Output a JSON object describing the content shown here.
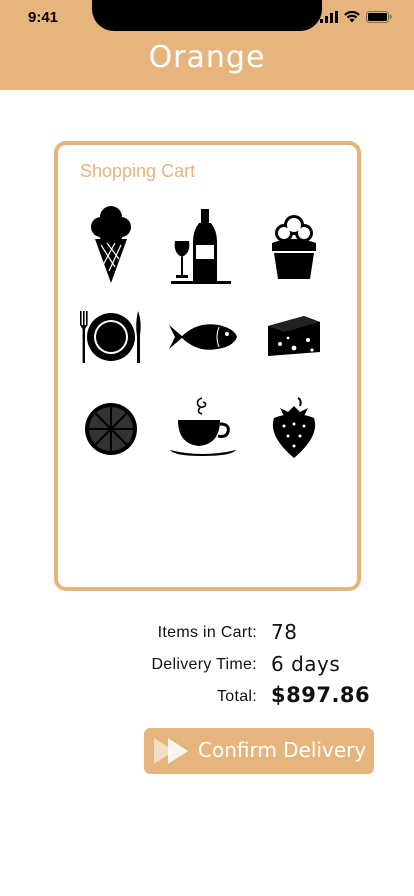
{
  "status_bar": {
    "time": "9:41"
  },
  "header": {
    "brand": "Orange",
    "brand_color": "#e5b57d"
  },
  "cart": {
    "title": "Shopping Cart",
    "items": [
      {
        "icon": "ice-cream-icon"
      },
      {
        "icon": "wine-icon"
      },
      {
        "icon": "cupcake-icon"
      },
      {
        "icon": "plate-cutlery-icon"
      },
      {
        "icon": "fish-icon"
      },
      {
        "icon": "cheese-icon"
      },
      {
        "icon": "orange-slice-icon"
      },
      {
        "icon": "coffee-cup-icon"
      },
      {
        "icon": "strawberry-icon"
      }
    ]
  },
  "summary": {
    "items_label": "Items in Cart:",
    "items_value": "78",
    "delivery_label": "Delivery Time:",
    "delivery_value": "6 days",
    "total_label": "Total:",
    "total_value": "$897.86"
  },
  "actions": {
    "confirm_label": "Confirm Delivery"
  }
}
